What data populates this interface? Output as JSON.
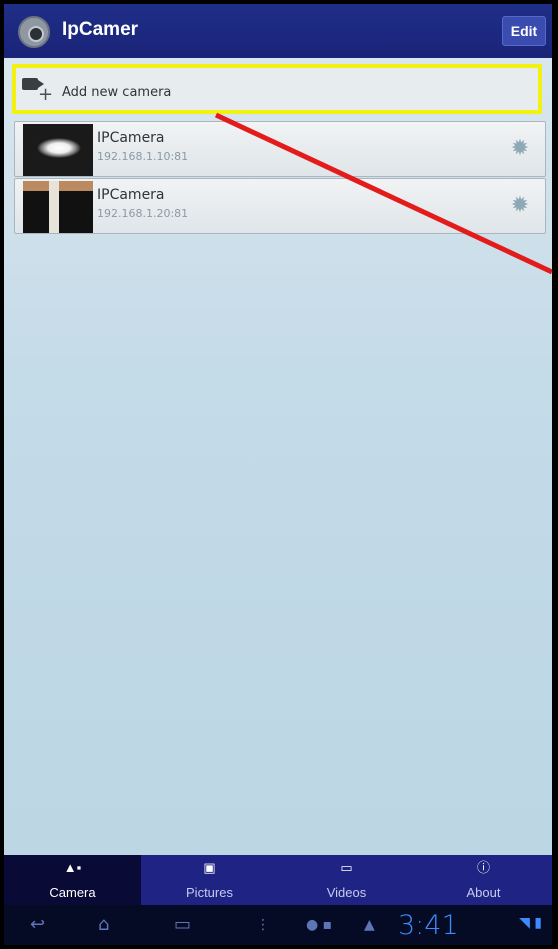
{
  "app": {
    "title": "IpCamer",
    "edit_label": "Edit"
  },
  "add_camera": {
    "label": "Add new camera",
    "plus": "+"
  },
  "cameras": [
    {
      "name": "IPCamera",
      "address": "192.168.1.10:81"
    },
    {
      "name": "IPCamera",
      "address": "192.168.1.20:81"
    }
  ],
  "tabs": [
    {
      "label": "Camera",
      "icon": "camera-icon",
      "glyph": "▲▪",
      "active": true
    },
    {
      "label": "Pictures",
      "icon": "pictures-icon",
      "glyph": "▣",
      "active": false
    },
    {
      "label": "Videos",
      "icon": "videos-icon",
      "glyph": "▭",
      "active": false
    },
    {
      "label": "About",
      "icon": "info-icon",
      "glyph": "ⓘ",
      "active": false
    }
  ],
  "system_bar": {
    "time": "3:41"
  },
  "colors": {
    "action_bar": "#1f2e88",
    "highlight": "#f1f20f",
    "pointer": "#e41b1b",
    "tab_bar": "#1f2384"
  }
}
